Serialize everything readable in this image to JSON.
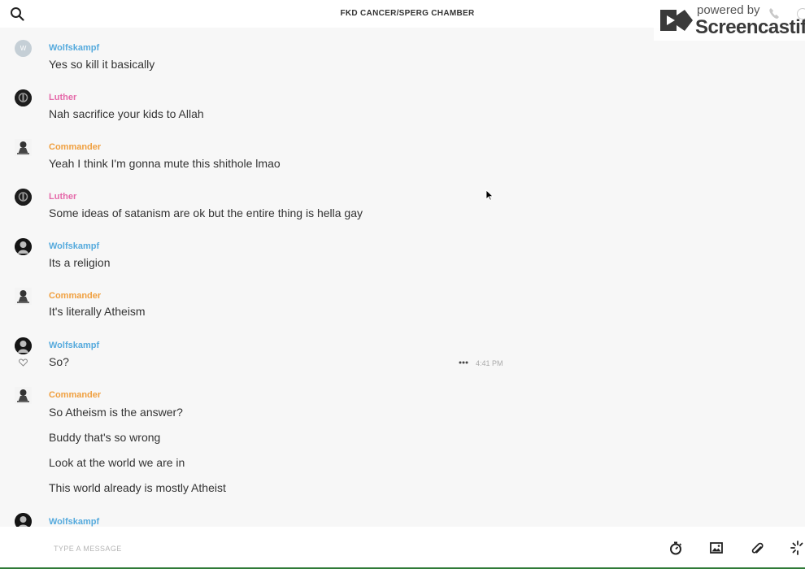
{
  "header": {
    "title": "FKD CANCER/SPERG CHAMBER",
    "search_icon": "search-icon"
  },
  "watermark": {
    "powered_by": "powered by",
    "brand": "Screencastify"
  },
  "messages": [
    {
      "sender": "Wolfskampf",
      "sender_color": "#55aadd",
      "avatar": "initial",
      "avatar_letter": "W",
      "lines": [
        "Yes so kill it basically"
      ]
    },
    {
      "sender": "Luther",
      "sender_color": "#e56aaa",
      "avatar": "dark",
      "lines": [
        "Nah sacrifice your kids to Allah"
      ]
    },
    {
      "sender": "Commander",
      "sender_color": "#f0a040",
      "avatar": "light",
      "lines": [
        "Yeah I think I'm gonna mute this shithole lmao"
      ]
    },
    {
      "sender": "Luther",
      "sender_color": "#e56aaa",
      "avatar": "dark",
      "lines": [
        "Some ideas of satanism are ok but the entire thing is hella gay"
      ]
    },
    {
      "sender": "Wolfskampf",
      "sender_color": "#55aadd",
      "avatar": "dark",
      "lines": [
        "Its a religion"
      ]
    },
    {
      "sender": "Commander",
      "sender_color": "#f0a040",
      "avatar": "light",
      "lines": [
        "It's literally Atheism"
      ]
    },
    {
      "sender": "Wolfskampf",
      "sender_color": "#55aadd",
      "avatar": "dark",
      "lines": [
        "So?"
      ],
      "time": "4:41 PM",
      "hovered": true
    },
    {
      "sender": "Commander",
      "sender_color": "#f0a040",
      "avatar": "light",
      "lines": [
        "So Atheism is the answer?",
        "Buddy that's so wrong",
        "Look at the world we are in",
        "This world already is mostly Atheist"
      ]
    },
    {
      "sender": "Wolfskampf",
      "sender_color": "#55aadd",
      "avatar": "dark",
      "lines": []
    }
  ],
  "composer": {
    "placeholder": "TYPE A MESSAGE",
    "tools": [
      "timer-icon",
      "image-icon",
      "paperclip-icon",
      "sparkle-icon"
    ]
  }
}
